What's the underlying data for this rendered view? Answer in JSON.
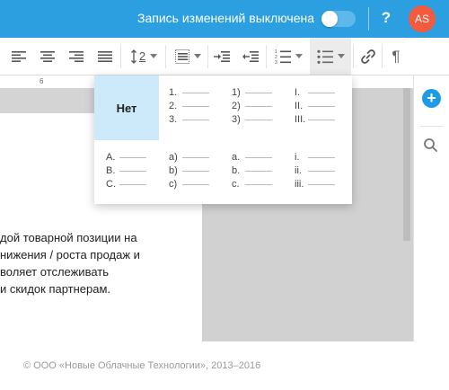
{
  "header": {
    "track_changes_label": "Запись изменений выключена",
    "track_changes_on": false,
    "help_label": "?",
    "avatar_initials": "AS",
    "accent_color": "#2b9fe0",
    "avatar_color": "#f35b3f"
  },
  "toolbar": {
    "line_spacing_value": "2",
    "icons": [
      "align-left-icon",
      "align-center-icon",
      "align-right-icon",
      "align-justify-icon",
      "line-spacing-icon",
      "paragraph-spacing-icon",
      "indent-increase-icon",
      "indent-decrease-icon",
      "numbered-list-icon",
      "bulleted-list-icon",
      "link-icon",
      "pilcrow-icon"
    ]
  },
  "ruler": {
    "mark": "6"
  },
  "list_dropdown": {
    "none_label": "Нет",
    "options": [
      [
        "1.",
        "2.",
        "3."
      ],
      [
        "1)",
        "2)",
        "3)"
      ],
      [
        "I.",
        "II.",
        "III."
      ],
      [
        "A.",
        "B.",
        "C."
      ],
      [
        "a)",
        "b)",
        "c)"
      ],
      [
        "a.",
        "b.",
        "c."
      ],
      [
        "i.",
        "ii.",
        "iii."
      ]
    ]
  },
  "document": {
    "lines": [
      "дой товарной позиции на",
      "нижения / роста продаж и",
      "воляет отслеживать",
      "и скидок партнерам."
    ]
  },
  "sidebar": {
    "add_label": "+"
  },
  "footer": {
    "copyright": "© ООО «Новые Облачные Технологии», 2013–2016"
  }
}
